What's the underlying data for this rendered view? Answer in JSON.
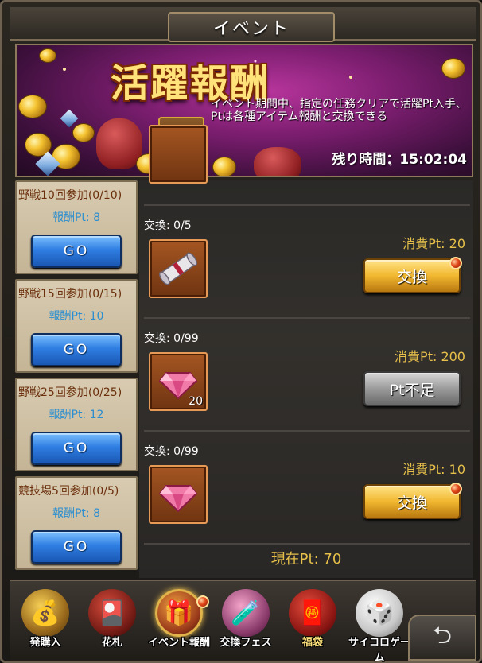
{
  "window": {
    "title": "イベント"
  },
  "banner": {
    "title": "活躍報酬",
    "description": "イベント期間中、指定の任務クリアで活躍Pt入手、Ptは各種アイテム報酬と交換できる",
    "timer_label": "残り時間：15:02:04"
  },
  "missions": [
    {
      "title": "野戦10回参加(0/10)",
      "reward": "報酬Pt: 8",
      "button": "GO"
    },
    {
      "title": "野戦15回参加(0/15)",
      "reward": "報酬Pt: 10",
      "button": "GO"
    },
    {
      "title": "野戦25回参加(0/25)",
      "reward": "報酬Pt: 12",
      "button": "GO"
    },
    {
      "title": "競技場5回参加(0/5)",
      "reward": "報酬Pt: 8",
      "button": "GO"
    }
  ],
  "exchange": {
    "rows": [
      {
        "count": "交換: 0/5",
        "item_icon": "scroll-icon",
        "item_qty": "",
        "cost": "消費Pt: 20",
        "button": "交換",
        "button_state": "enabled"
      },
      {
        "count": "交換: 0/99",
        "item_icon": "gem-icon",
        "item_qty": "20",
        "cost": "消費Pt: 200",
        "button": "Pt不足",
        "button_state": "disabled"
      },
      {
        "count": "交換: 0/99",
        "item_icon": "gem-icon",
        "item_qty": "",
        "cost": "消費Pt: 10",
        "button": "交換",
        "button_state": "enabled"
      }
    ],
    "current_pt": "現在Pt: 70"
  },
  "bottom_tabs": [
    {
      "label": "発購入",
      "icon": "treasure-pot-icon"
    },
    {
      "label": "花札",
      "icon": "cards-icon"
    },
    {
      "label": "イベント報酬",
      "icon": "gift-box-icon",
      "active": true
    },
    {
      "label": "交換フェス",
      "icon": "bottles-icon"
    },
    {
      "label": "福袋",
      "icon": "lucky-bag-icon"
    },
    {
      "label": "サイコロゲーム",
      "icon": "dice-icon"
    }
  ],
  "colors": {
    "pt_gold": "#e6c04a",
    "reward_blue": "#2a8ed0",
    "mission_title": "#6a2e0b"
  }
}
